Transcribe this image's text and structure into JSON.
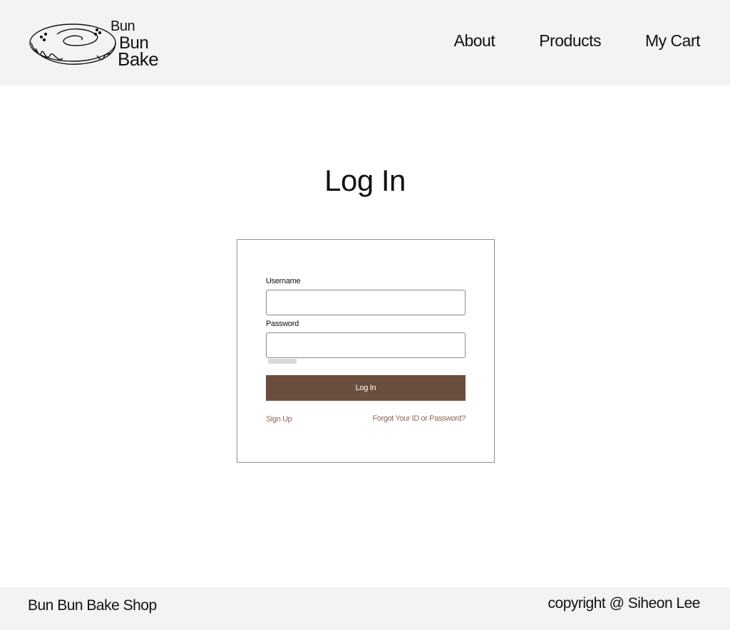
{
  "header": {
    "logo": {
      "line1": "Bun",
      "line2": "Bun",
      "line3": "Bake",
      "icon": "cinnamon-roll-icon"
    },
    "nav": [
      {
        "label": "About"
      },
      {
        "label": "Products"
      },
      {
        "label": "My Cart"
      }
    ]
  },
  "main": {
    "title": "Log In",
    "form": {
      "username_label": "Username",
      "username_value": "",
      "password_label": "Password",
      "password_value": "",
      "submit_label": "Log In",
      "signup_label": "Sign Up",
      "forgot_label": "Forgot Your ID or Password?"
    }
  },
  "footer": {
    "left": "Bun Bun Bake Shop",
    "right": "copyright @ Siheon Lee"
  },
  "colors": {
    "header_bg": "#f4f3f1",
    "button_bg": "#6b4e3d",
    "link": "#8a6a5a"
  }
}
